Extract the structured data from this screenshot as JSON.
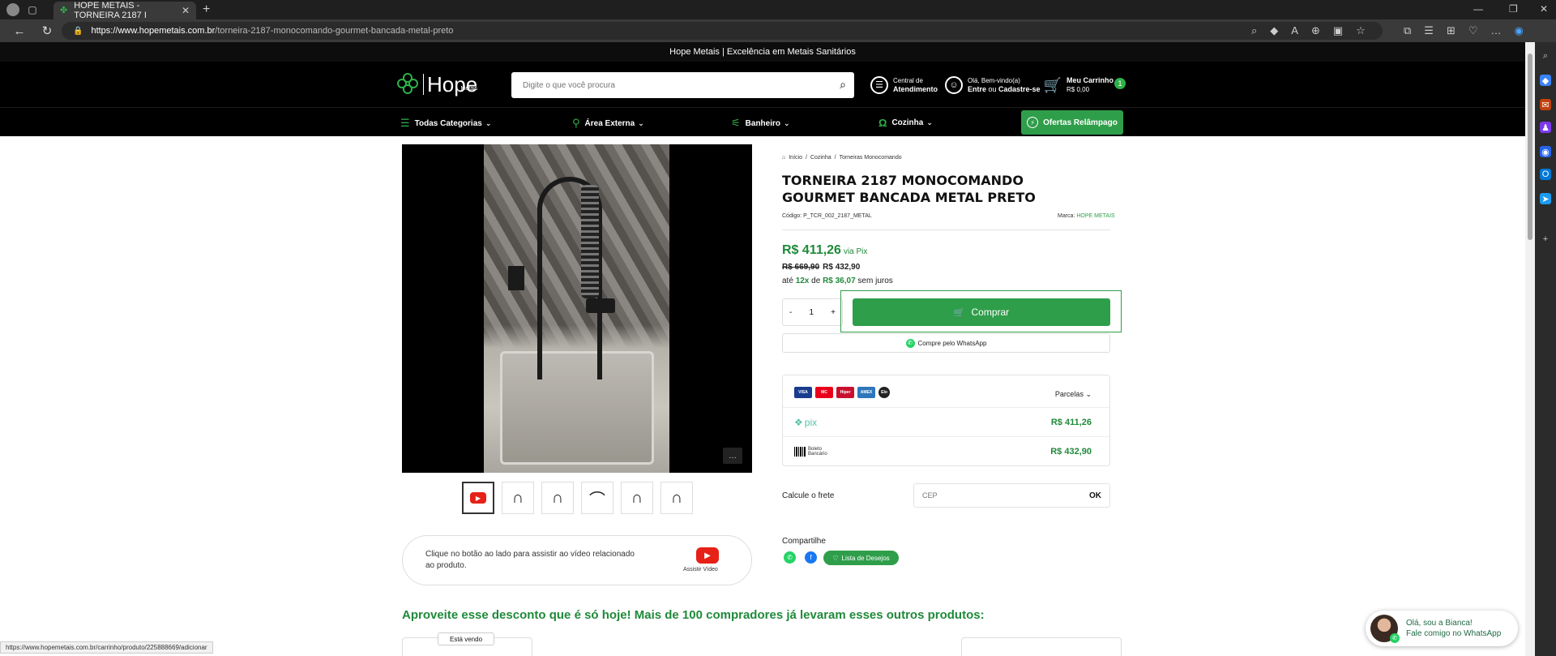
{
  "browser": {
    "tab_title": "HOPE METAIS - TORNEIRA 2187 I",
    "url_host": "https://www.hopemetais.com.br",
    "url_path": "/torneira-2187-monocomando-gourmet-bancada-metal-preto",
    "status_url": "https://www.hopemetais.com.br/carrinho/produto/225888669/adicionar"
  },
  "site": {
    "promo_text": "Hope Metais | Excelência em Metais Sanitários",
    "logo_text": "Hope",
    "logo_sub": "Metais",
    "search_placeholder": "Digite o que você procura",
    "atendimento_line1": "Central de",
    "atendimento_line2": "Atendimento",
    "account_line1": "Olá, Bem-vindo(a)",
    "account_line2_a": "Entre",
    "account_line2_b": " ou ",
    "account_line2_c": "Cadastre-se",
    "cart_label": "Meu Carrinho",
    "cart_total": "R$ 0,00",
    "cart_count": "1",
    "categories": [
      "Todas Categorias",
      "Área Externa",
      "Banheiro",
      "Cozinha"
    ],
    "flash_label": "Ofertas Relâmpago"
  },
  "product": {
    "breadcrumb": [
      "Início",
      "/",
      "Cozinha",
      "/",
      "Torneiras Monocomando"
    ],
    "title": "TORNEIRA 2187 MONOCOMANDO GOURMET BANCADA METAL PRETO",
    "code_label": "Código:",
    "code_value": "P_TCR_002_2187_METAL",
    "brand_label": "Marca:",
    "brand_value": "HOPE METAIS",
    "price_pix": "R$ 411,26",
    "price_pix_suffix": "via Pix",
    "price_old": "R$ 669,90",
    "price_card": "R$ 432,90",
    "installments_a": "até ",
    "installments_n": "12x",
    "installments_b": " de ",
    "installments_v": "R$ 36,07",
    "installments_c": " sem juros",
    "qty": "1",
    "qty_minus": "-",
    "qty_plus": "+",
    "buy_label": "Comprar",
    "whatsapp_label": "Compre pelo WhatsApp",
    "video_text": "Clique no botão ao lado para assistir ao vídeo relacionado ao produto.",
    "video_button_label": "Assistir Vídeo"
  },
  "payment": {
    "parcelas_label": "Parcelas",
    "pix_logo": "pix",
    "pix_value": "R$ 411,26",
    "boleto_logo_line1": "Boleto",
    "boleto_logo_line2": "Bancário",
    "boleto_value": "R$ 432,90",
    "cards": [
      {
        "name": "VISA",
        "color": "#1a3c8f"
      },
      {
        "name": "MC",
        "color": "#eb001b"
      },
      {
        "name": "Hiper",
        "color": "#c8102e"
      },
      {
        "name": "AMEX",
        "color": "#2e77bb"
      },
      {
        "name": "Elo",
        "color": "#222222"
      }
    ]
  },
  "shipping": {
    "label": "Calcule o frete",
    "cep_placeholder": "CEP",
    "ok_label": "OK"
  },
  "share": {
    "label": "Compartilhe",
    "wishlist_label": "Lista de Desejos"
  },
  "deals": {
    "heading": "Aproveite esse desconto que é só hoje! Mais de 100 compradores já levaram esses outros produtos:",
    "selling_badge": "Está vendo"
  },
  "chat": {
    "line1": "Olá, sou a Bianca!",
    "line2": "Fale comigo no WhatsApp"
  },
  "colors": {
    "brand_green": "#2f9e4a",
    "price_green": "#1f8a3a",
    "header_bg": "#000000"
  }
}
